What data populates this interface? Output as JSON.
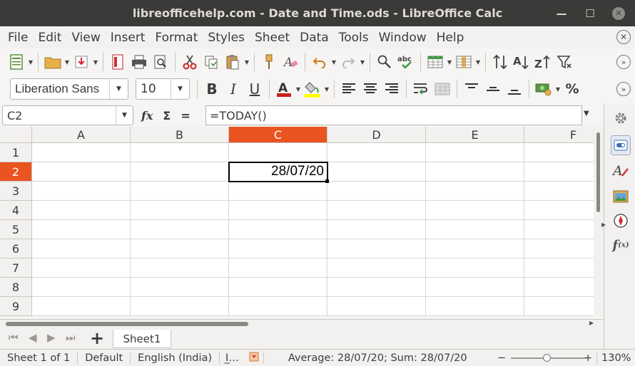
{
  "window": {
    "title": "libreofficehelp.com - Date and Time.ods - LibreOffice Calc",
    "minimize": "—",
    "maximize": "☐",
    "close": "✕"
  },
  "menu": [
    "File",
    "Edit",
    "View",
    "Insert",
    "Format",
    "Styles",
    "Sheet",
    "Data",
    "Tools",
    "Window",
    "Help"
  ],
  "formatting": {
    "font_name": "Liberation Sans",
    "font_size": "10",
    "bold": "B",
    "italic": "I",
    "underline": "U",
    "percent": "%"
  },
  "formula_bar": {
    "cell_ref": "C2",
    "fx_label": "fx",
    "sum_label": "Σ",
    "equals_label": "=",
    "formula": "=TODAY()"
  },
  "grid": {
    "columns": [
      "A",
      "B",
      "C",
      "D",
      "E",
      "F"
    ],
    "rows": [
      "1",
      "2",
      "3",
      "4",
      "5",
      "6",
      "7",
      "8",
      "9"
    ],
    "active_column": "C",
    "active_row": "2",
    "cell_c2_value": "28/07/20"
  },
  "sheets": {
    "tabs": [
      "Sheet1"
    ],
    "add_label": "+"
  },
  "status": {
    "sheet_pos": "Sheet 1 of 1",
    "page_style": "Default",
    "language": "English (India)",
    "summary": "Average: 28/07/20; Sum: 28/07/20",
    "zoom": "130%",
    "zoom_minus": "−",
    "zoom_plus": "+",
    "zoom_level": 0.48
  },
  "colors": {
    "accent": "#e95420",
    "titlebar": "#3a3a38"
  },
  "sidebar_icons": [
    "gear-icon",
    "properties-icon",
    "styles-icon",
    "gallery-icon",
    "navigator-icon",
    "functions-icon"
  ]
}
